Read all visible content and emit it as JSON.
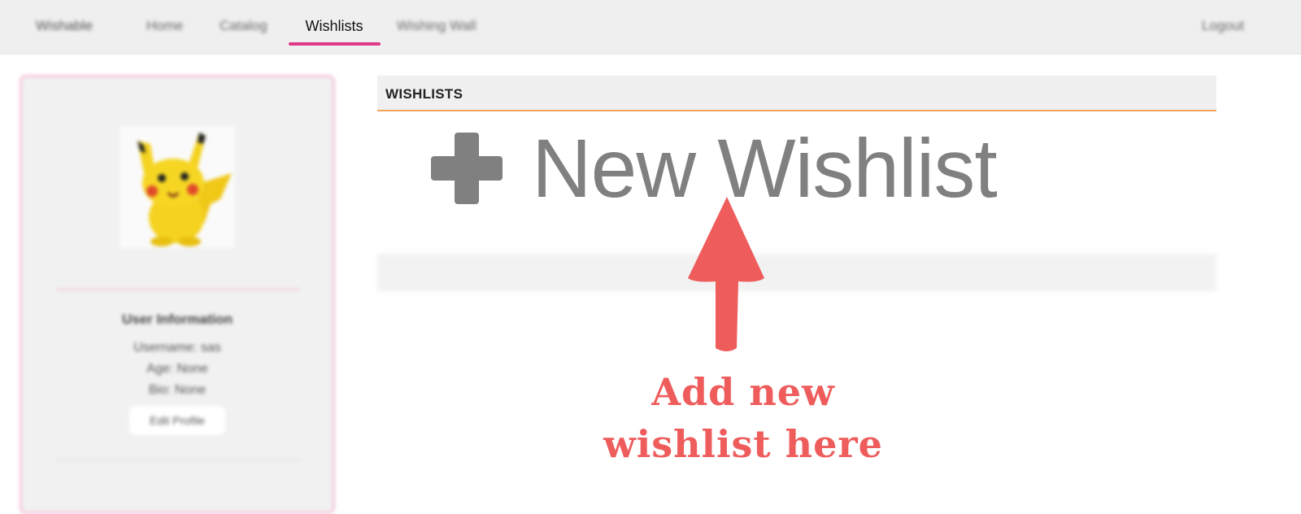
{
  "nav": {
    "brand": "Wishable",
    "items": [
      "Home",
      "Catalog",
      "Wishlists",
      "Wishing Wall"
    ],
    "active": "Wishlists",
    "logout": "Logout",
    "accent_color": "#e0398a"
  },
  "sidebar": {
    "avatar_alt": "pikachu-avatar",
    "info_title": "User Information",
    "username": "Username: sas",
    "age": "Age: None",
    "bio": "Bio: None",
    "edit_button": "Edit Profile"
  },
  "main": {
    "section_title": "WISHLISTS",
    "new_wishlist_label": "New Wishlist",
    "header_border_color": "#f0a35a"
  },
  "annotation": {
    "line1": "Add new",
    "line2": "wishlist here",
    "color": "#ee5c5c"
  }
}
